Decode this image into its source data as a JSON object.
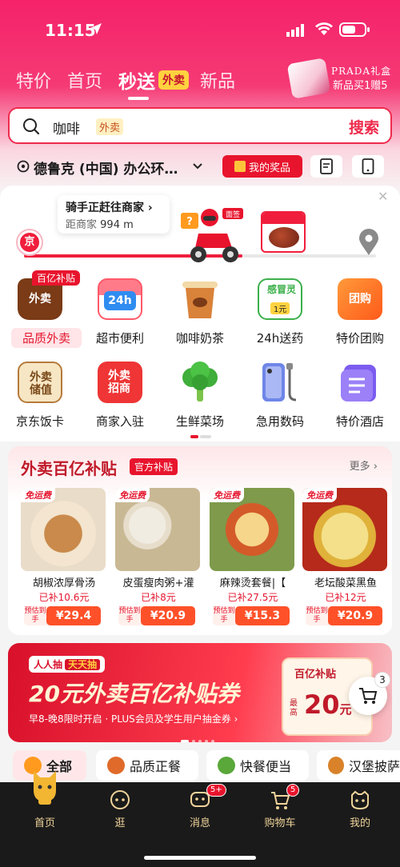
{
  "status": {
    "time": "11:15"
  },
  "top_tabs": [
    {
      "label": "特价"
    },
    {
      "label": "首页"
    },
    {
      "label": "秒送",
      "active": true,
      "badge": "外卖"
    },
    {
      "label": "新品"
    }
  ],
  "promo": {
    "brand": "PRADA礼盒",
    "text": "新品买1赠5"
  },
  "search": {
    "query": "咖啡",
    "tag": "外卖",
    "button": "搜索"
  },
  "address": {
    "text": "德鲁克 (中国) 办公环…",
    "prize_button": "我的奖品"
  },
  "delivery": {
    "title": "骑手正赶往商家",
    "distance_prefix": "距商家",
    "distance": "994 m",
    "start_label": "京",
    "progress": 0.62
  },
  "categories": [
    {
      "label": "品质外卖",
      "icon": "takeout-bag-icon",
      "icon_text": "外卖",
      "ribbon": "百亿补贴",
      "color": "#7a3b16",
      "highlight": true
    },
    {
      "label": "超市便利",
      "icon": "24h-store-icon",
      "icon_text": "24h",
      "color": "#ff5a6a"
    },
    {
      "label": "咖啡奶茶",
      "icon": "coffee-cup-icon",
      "icon_text": "",
      "color": "#d9823a"
    },
    {
      "label": "24h送药",
      "icon": "medicine-box-icon",
      "icon_text": "感冒灵",
      "color": "#3cb04a"
    },
    {
      "label": "特价团购",
      "icon": "group-buy-icon",
      "icon_text": "团购",
      "color": "#ff7a1a"
    },
    {
      "label": "京东饭卡",
      "icon": "meal-card-icon",
      "icon_text": "外卖储值",
      "color": "#7a4a1a"
    },
    {
      "label": "商家入驻",
      "icon": "merchant-join-icon",
      "icon_text": "外卖招商",
      "color": "#ef3535"
    },
    {
      "label": "生鲜菜场",
      "icon": "broccoli-icon",
      "icon_text": "",
      "color": "#3fae3a"
    },
    {
      "label": "急用数码",
      "icon": "phone-cable-icon",
      "icon_text": "",
      "color": "#6f86e8"
    },
    {
      "label": "特价酒店",
      "icon": "hotel-icon",
      "icon_text": "",
      "color": "#7b5cf0"
    }
  ],
  "subsidy": {
    "title": "外卖百亿补贴",
    "badge": "官方补贴",
    "more": "更多 ›",
    "items": [
      {
        "free_tag": "免运费",
        "name": "胡椒浓厚骨汤",
        "subsidy": "已补10.6元",
        "price_label": "预估到手",
        "price": "¥29.4",
        "colors": [
          "#f3e5cf",
          "#c98a4b"
        ]
      },
      {
        "free_tag": "免运费",
        "name": "皮蛋瘦肉粥+灌",
        "subsidy": "已补8元",
        "price_label": "预估到手",
        "price": "¥20.9",
        "colors": [
          "#f1ece2",
          "#e0a35a"
        ]
      },
      {
        "free_tag": "免运费",
        "name": "麻辣烫套餐|【",
        "subsidy": "已补27.5元",
        "price_label": "预估到手",
        "price": "¥15.3",
        "colors": [
          "#f6d68a",
          "#d45a2a"
        ]
      },
      {
        "free_tag": "免运费",
        "name": "老坛酸菜黑鱼",
        "subsidy": "已补12元",
        "price_label": "预估到手",
        "price": "¥20.9",
        "colors": [
          "#f4e08a",
          "#e0b23a"
        ]
      }
    ]
  },
  "banner": {
    "tag1": "人人抽",
    "tag2": "天天抽",
    "title": "20元外卖百亿补贴券",
    "subtitle": "早8-晚8限时开启 · PLUS会员及学生用户抽金券 ›",
    "coupon_header": "百亿补贴",
    "coupon_max": "最高",
    "coupon_value": "20",
    "coupon_unit": "元"
  },
  "cart_count": "3",
  "chips": [
    {
      "label": "全部",
      "active": true
    },
    {
      "label": "品质正餐"
    },
    {
      "label": "快餐便当"
    },
    {
      "label": "汉堡披萨"
    }
  ],
  "tabbar": [
    {
      "label": "首页",
      "icon": "home-mascot-icon"
    },
    {
      "label": "逛",
      "icon": "browse-icon"
    },
    {
      "label": "消息",
      "icon": "message-icon",
      "badge": "5+"
    },
    {
      "label": "购物车",
      "icon": "cart-icon",
      "badge": "5"
    },
    {
      "label": "我的",
      "icon": "profile-icon"
    }
  ],
  "colors": {
    "brand_red": "#e8142d",
    "header_pink": "#f5226a",
    "tabbar_bg": "#1a1a1a",
    "tabbar_text": "#f0d49a"
  }
}
